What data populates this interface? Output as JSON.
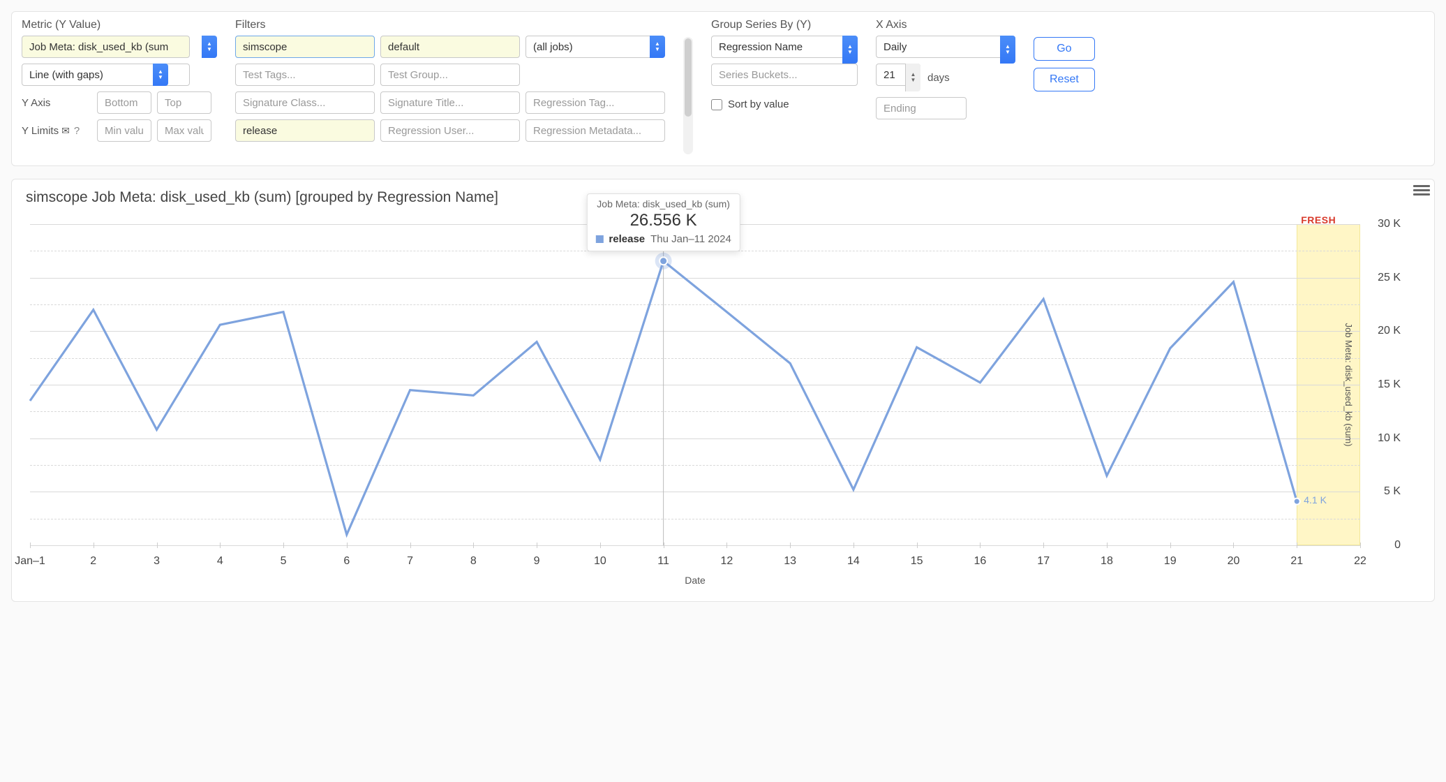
{
  "metric": {
    "label": "Metric (Y Value)",
    "select_value": "Job Meta: disk_used_kb (sum)",
    "chart_type": "Line (with gaps)",
    "yaxis_label": "Y Axis",
    "bottom_placeholder": "Bottom",
    "top_placeholder": "Top",
    "ylimits_label": "Y Limits",
    "ylimits_help": "?",
    "min_placeholder": "Min value",
    "max_placeholder": "Max value"
  },
  "filters": {
    "label": "Filters",
    "fields": {
      "component": {
        "value": "simscope",
        "placeholder": ""
      },
      "branch": {
        "value": "default",
        "placeholder": ""
      },
      "jobs": {
        "value": "(all jobs)",
        "placeholder": ""
      },
      "test_tags": {
        "value": "",
        "placeholder": "Test Tags..."
      },
      "test_group": {
        "value": "",
        "placeholder": "Test Group..."
      },
      "sig_class": {
        "value": "",
        "placeholder": "Signature Class..."
      },
      "sig_title": {
        "value": "",
        "placeholder": "Signature Title..."
      },
      "reg_tag": {
        "value": "",
        "placeholder": "Regression Tag..."
      },
      "release": {
        "value": "release",
        "placeholder": ""
      },
      "reg_user": {
        "value": "",
        "placeholder": "Regression User..."
      },
      "reg_meta": {
        "value": "",
        "placeholder": "Regression Metadata..."
      }
    }
  },
  "group": {
    "label": "Group Series By (Y)",
    "select_value": "Regression Name",
    "buckets_placeholder": "Series Buckets...",
    "sort_label": "Sort by value"
  },
  "xaxis": {
    "label": "X Axis",
    "select_value": "Daily",
    "days_value": "21",
    "days_label": "days",
    "ending_placeholder": "Ending"
  },
  "buttons": {
    "go": "Go",
    "reset": "Reset"
  },
  "chart": {
    "title": "simscope Job Meta: disk_used_kb (sum) [grouped by Regression Name]",
    "legend_series": "release",
    "fresh_label": "FRESH",
    "x_axis_title": "Date",
    "y_axis_title": "Job Meta: disk_used_kb (sum)",
    "tooltip": {
      "title": "Job Meta: disk_used_kb (sum)",
      "value": "26.556 K",
      "series": "release",
      "date": "Thu Jan–11 2024"
    },
    "last_value_label": "4.1 K"
  },
  "chart_data": {
    "type": "line",
    "title": "simscope Job Meta: disk_used_kb (sum) [grouped by Regression Name]",
    "xlabel": "Date",
    "ylabel": "Job Meta: disk_used_kb (sum)",
    "ylim": [
      0,
      30000
    ],
    "y_ticks": [
      0,
      5000,
      10000,
      15000,
      20000,
      25000,
      30000
    ],
    "y_tick_labels": [
      "0",
      "5 K",
      "10 K",
      "15 K",
      "20 K",
      "25 K",
      "30 K"
    ],
    "categories": [
      "Jan–1",
      "2",
      "3",
      "4",
      "5",
      "6",
      "7",
      "8",
      "9",
      "10",
      "11",
      "12",
      "13",
      "14",
      "15",
      "16",
      "17",
      "18",
      "19",
      "20",
      "21",
      "22"
    ],
    "x_range": [
      1,
      22
    ],
    "series": [
      {
        "name": "release",
        "color": "#7ea3de",
        "x": [
          1,
          2,
          3,
          4,
          5,
          6,
          7,
          8,
          9,
          10,
          11,
          12,
          13,
          14,
          15,
          16,
          17,
          18,
          19,
          20,
          21
        ],
        "values": [
          13500,
          22000,
          10800,
          20600,
          21800,
          1000,
          14500,
          14000,
          19000,
          8000,
          26556,
          21800,
          17000,
          5200,
          18500,
          15200,
          23000,
          6500,
          18400,
          24600,
          4100
        ]
      }
    ],
    "highlight": {
      "index": 10,
      "value": 26556,
      "label": "26.556 K",
      "date": "Thu Jan–11 2024"
    },
    "fresh_band_x": [
      21,
      22
    ],
    "last_point_label": "4.1 K"
  }
}
